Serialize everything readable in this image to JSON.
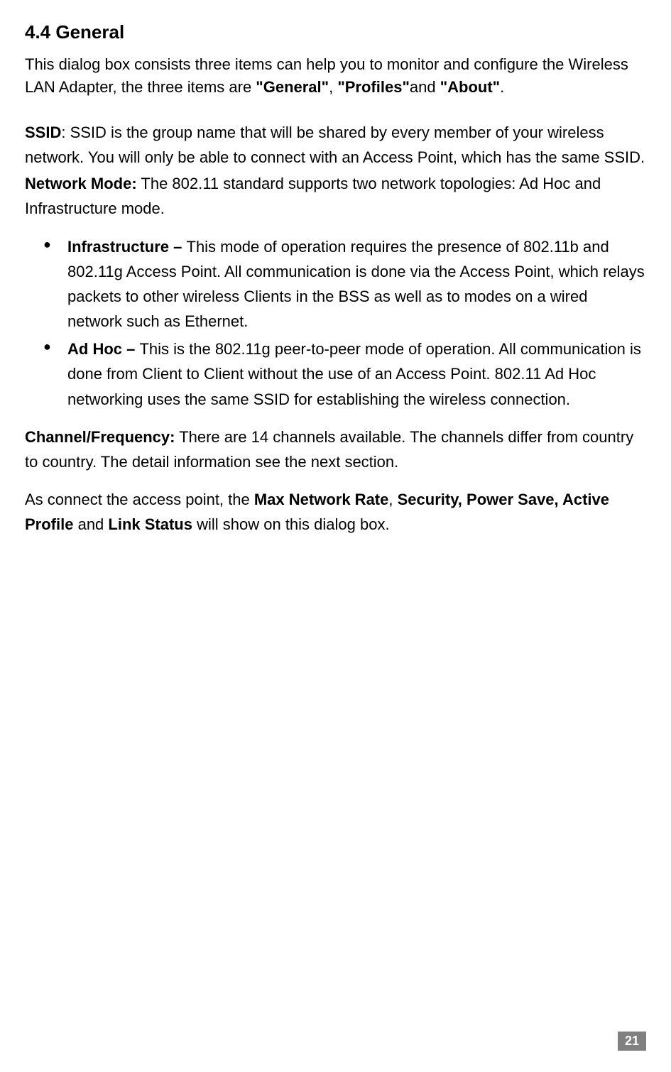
{
  "heading": "4.4  General",
  "intro": {
    "pre": "This dialog box consists three items can help you to monitor and configure the Wireless LAN Adapter, the three items are ",
    "b1": "\"General\"",
    "mid1": ", ",
    "b2": "\"Profiles\"",
    "mid2": "and ",
    "b3": "\"About\"",
    "end": "."
  },
  "ssid": {
    "label": "SSID",
    "text": ": SSID is the group name that will be shared by every member of your wireless network. You will only be able to connect with an Access Point, which has the same SSID."
  },
  "network_mode": {
    "label": "Network Mode:",
    "text": " The 802.11 standard supports two network topologies: Ad Hoc and Infrastructure mode."
  },
  "bullets": [
    {
      "label": "Infrastructure – ",
      "text": "This mode of operation requires the presence of 802.11b and 802.11g Access Point. All communication is done via the Access Point, which relays packets to other wireless Clients in the BSS as well as to modes on a wired network such as Ethernet."
    },
    {
      "label": "Ad Hoc – ",
      "text": "This is the 802.11g peer-to-peer mode of operation. All communication is done from Client to Client without the use of an Access Point. 802.11 Ad Hoc networking uses the same SSID for establishing the wireless connection."
    }
  ],
  "channel": {
    "label": "Channel/Frequency:",
    "text": " There are 14 channels available. The channels differ from country to country. The detail information see the next section."
  },
  "closing": {
    "pre": "As connect the access point, the ",
    "b1": "Max Network Rate",
    "mid1": ", ",
    "b2": "Security, Power Save, Active Profile",
    "mid2": " and ",
    "b3": "Link Status",
    "end": " will show on this dialog box."
  },
  "page_number": "21"
}
